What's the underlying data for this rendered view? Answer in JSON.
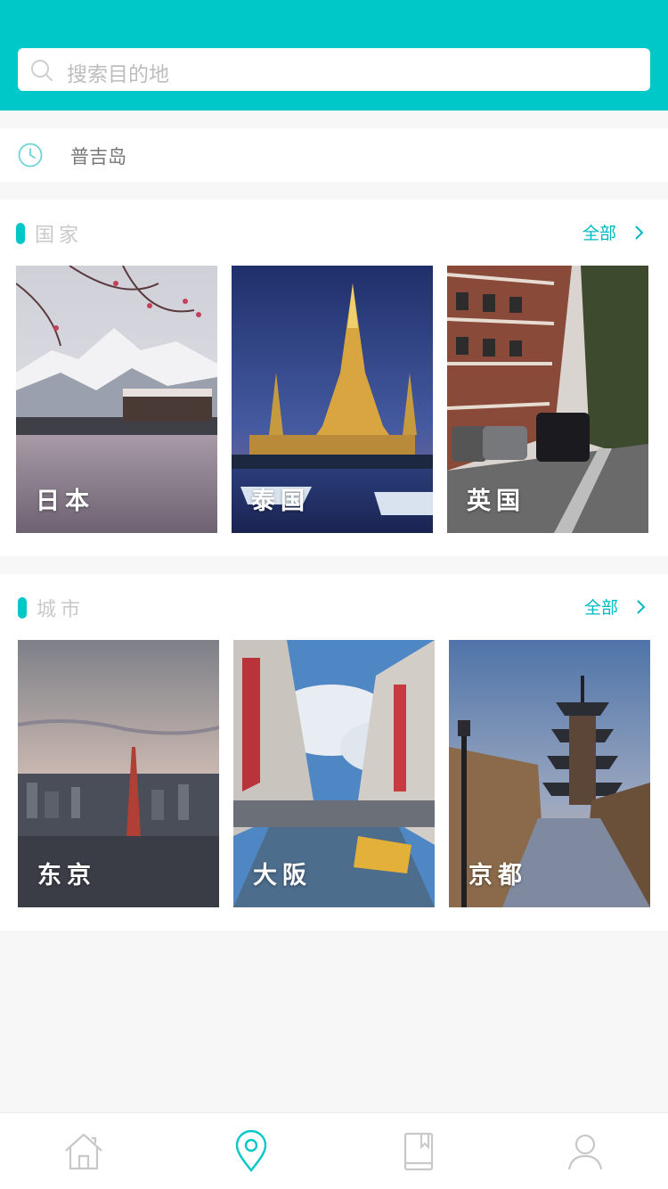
{
  "search": {
    "placeholder": "搜索目的地"
  },
  "history": {
    "item": "普吉岛"
  },
  "countries": {
    "title": "国家",
    "all_label": "全部",
    "items": [
      {
        "label": "日本"
      },
      {
        "label": "泰国"
      },
      {
        "label": "英国"
      }
    ]
  },
  "cities": {
    "title": "城市",
    "all_label": "全部",
    "items": [
      {
        "label": "东京"
      },
      {
        "label": "大阪"
      },
      {
        "label": "京都"
      }
    ]
  },
  "tabs": [
    {
      "icon": "home-icon"
    },
    {
      "icon": "location-icon",
      "active": true
    },
    {
      "icon": "book-icon"
    },
    {
      "icon": "user-icon"
    }
  ],
  "colors": {
    "accent": "#00c8c9",
    "inactive": "#c8c8c8"
  }
}
